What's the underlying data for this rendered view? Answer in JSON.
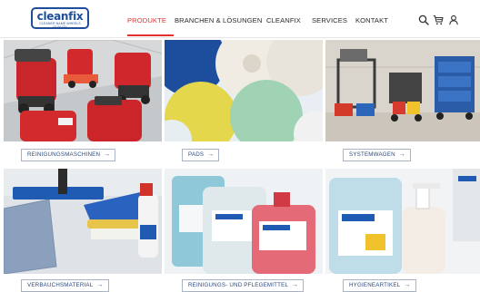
{
  "logo": {
    "word": "cleanfix",
    "tagline": "CLEANER NAME WHEELS QUALITY"
  },
  "nav": {
    "items": [
      {
        "label": "PRODUKTE"
      },
      {
        "label": "BRANCHEN & LÖSUNGEN"
      },
      {
        "label": "CLEANFIX"
      },
      {
        "label": "SERVICES"
      },
      {
        "label": "KONTAKT"
      }
    ]
  },
  "categories": [
    {
      "label": "REINIGUNGSMASCHINEN",
      "arrow": "→"
    },
    {
      "label": "PADS",
      "arrow": "→"
    },
    {
      "label": "SYSTEMWAGEN",
      "arrow": "→"
    },
    {
      "label": "VERBAUCHSMATERIAL",
      "arrow": "→"
    },
    {
      "label": "REINIGUNGS- UND PFLEGEMITTEL",
      "arrow": "→"
    },
    {
      "label": "HYGIENEARTIKEL",
      "arrow": "→"
    }
  ],
  "colors": {
    "accent": "#e1312c",
    "brand": "#1f4f9a",
    "button_text": "#2b4a80"
  },
  "icons": [
    "search-icon",
    "cart-icon",
    "user-icon",
    "arrow-right-icon"
  ]
}
